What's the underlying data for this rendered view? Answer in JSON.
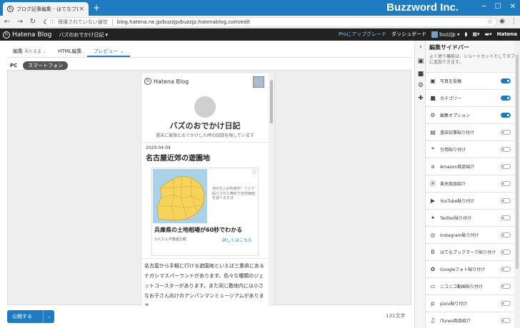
{
  "browser": {
    "tab_title": "ブログ記事編集 - はてなブログ",
    "brand": "Buzzword Inc.",
    "security_label": "保護されていない通信",
    "url": "blog.hatena.ne.jp/buzzjp/buzzjp.hatenablog.com/edit"
  },
  "header": {
    "logo": "Hatena Blog",
    "blog_menu": "バズのおでかけ日記 ▾",
    "pro_upgrade": "Proにアップグレード",
    "dashboard": "ダッシュボード",
    "user": "buzzjp ▾",
    "hatena": "Hatena"
  },
  "editor": {
    "tabs": [
      {
        "label": "編集",
        "sub": "見たまま ⌄"
      },
      {
        "label": "HTML編集",
        "sub": ""
      },
      {
        "label": "プレビュー ⌄",
        "sub": ""
      }
    ],
    "device_pc": "PC",
    "device_sp": "スマートフォン"
  },
  "preview": {
    "logo": "Hatena Blog",
    "blog_title": "バズのおでかけ日記",
    "blog_desc": "週末に家族とおでかけした時の記録を残しています",
    "post_date": "2020-04-04",
    "post_title": "名古屋近郊の遊園地",
    "ad_info": "ⓘ",
    "ad_text": "300万人が利用中！ＴＶで紹介された無料で自宅価値を調べる方法",
    "ad_headline": "兵庫県の土地相場が60秒でわかる",
    "ad_source": "かんたん不動産比較",
    "ad_link": "詳しくはこちら",
    "body": "名古屋から手軽に行ける遊園地といえば三重県にあるナガシマスパーランドがあります。色々な種類のジェットコースターがあります。また同じ敷地内には小さなお子さん向けのアンパンマンミュージアムがあります。"
  },
  "footer": {
    "publish": "公開する",
    "publish_arrow": "⌄",
    "char_count": "131文字"
  },
  "sidebar": {
    "title": "編集サイドバー",
    "desc": "よく使う機能は、ショートカットとしてタブに追加できます。",
    "items": [
      {
        "label": "写真を投稿",
        "icon": "photo-icon",
        "on": true
      },
      {
        "label": "カテゴリー",
        "icon": "folder-icon",
        "on": true
      },
      {
        "label": "編集オプション",
        "icon": "gear-icon",
        "on": true
      },
      {
        "label": "過去記事貼り付け",
        "icon": "document-icon",
        "on": false
      },
      {
        "label": "引用貼り付け",
        "icon": "quote-icon",
        "on": false
      },
      {
        "label": "Amazon商品紹介",
        "icon": "amazon-icon",
        "on": false
      },
      {
        "label": "楽天商品紹介",
        "icon": "rakuten-icon",
        "on": false
      },
      {
        "label": "YouTube貼り付け",
        "icon": "youtube-icon",
        "on": false
      },
      {
        "label": "Twitter貼り付け",
        "icon": "twitter-icon",
        "on": false
      },
      {
        "label": "Instagram貼り付け",
        "icon": "instagram-icon",
        "on": false
      },
      {
        "label": "はてなブックマーク貼り付け",
        "icon": "hatena-bookmark-icon",
        "on": false
      },
      {
        "label": "Googleフォト貼り付け",
        "icon": "google-photos-icon",
        "on": false
      },
      {
        "label": "ニコニコ動画貼り付け",
        "icon": "niconico-icon",
        "on": false
      },
      {
        "label": "pixiv貼り付け",
        "icon": "pixiv-icon",
        "on": false
      },
      {
        "label": "iTunes商品紹介",
        "icon": "music-icon",
        "on": false
      }
    ]
  },
  "colors": {
    "accent": "#1f7bbf",
    "header_bg": "#222222"
  }
}
